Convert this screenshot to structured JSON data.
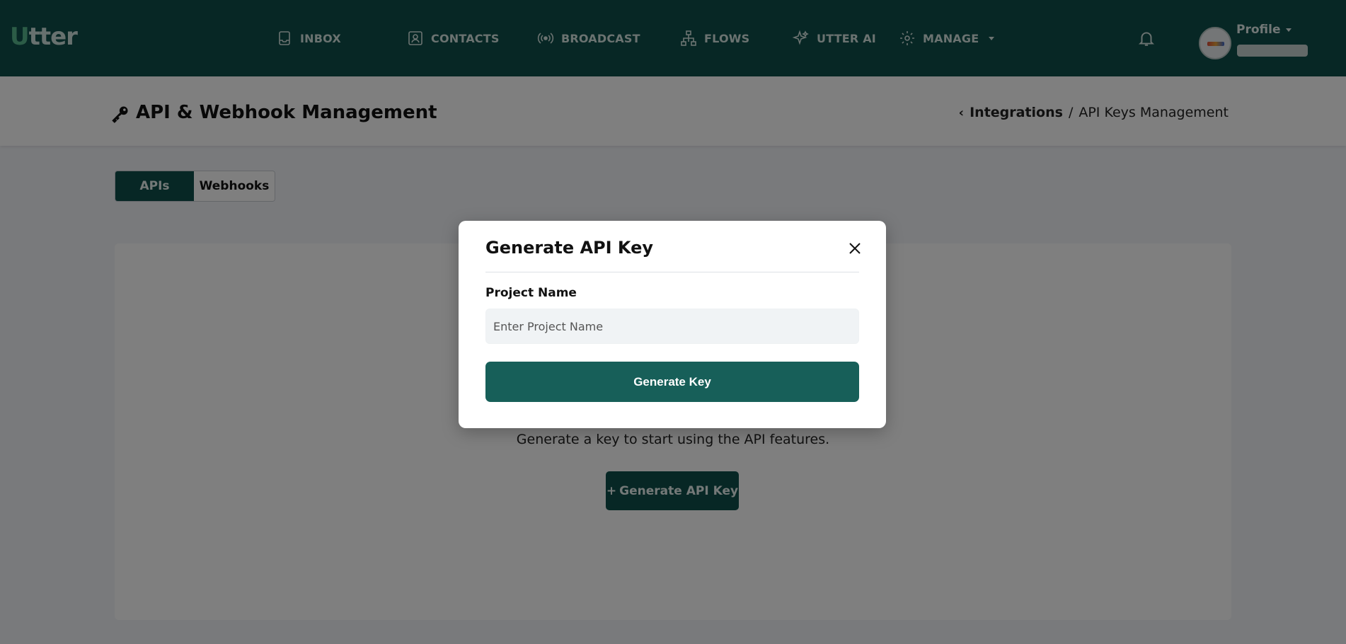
{
  "nav": {
    "logo": "utter",
    "items": [
      {
        "label": "INBOX",
        "icon": "inbox-icon"
      },
      {
        "label": "CONTACTS",
        "icon": "contacts-icon"
      },
      {
        "label": "BROADCAST",
        "icon": "broadcast-icon"
      },
      {
        "label": "FLOWS",
        "icon": "flows-icon"
      },
      {
        "label": "UTTER AI",
        "icon": "sparkle-icon"
      },
      {
        "label": "MANAGE",
        "icon": "gear-icon"
      }
    ],
    "profile_label": "Profile"
  },
  "header": {
    "title": "API & Webhook Management",
    "breadcrumb_link": "Integrations",
    "breadcrumb_sep": "/",
    "breadcrumb_current": "API Keys Management"
  },
  "tabs": [
    {
      "label": "APIs",
      "active": true
    },
    {
      "label": "Webhooks",
      "active": false
    }
  ],
  "main": {
    "empty_text": "Generate a key to start using the API features.",
    "generate_button": "Generate API Key",
    "plus": "+"
  },
  "modal": {
    "title": "Generate API Key",
    "field_label": "Project Name",
    "field_placeholder": "Enter Project Name",
    "field_value": "",
    "submit_label": "Generate Key"
  },
  "colors": {
    "brand": "#0e4f4a",
    "brand_button": "#175f59",
    "logo_accent": "#58b98e"
  }
}
